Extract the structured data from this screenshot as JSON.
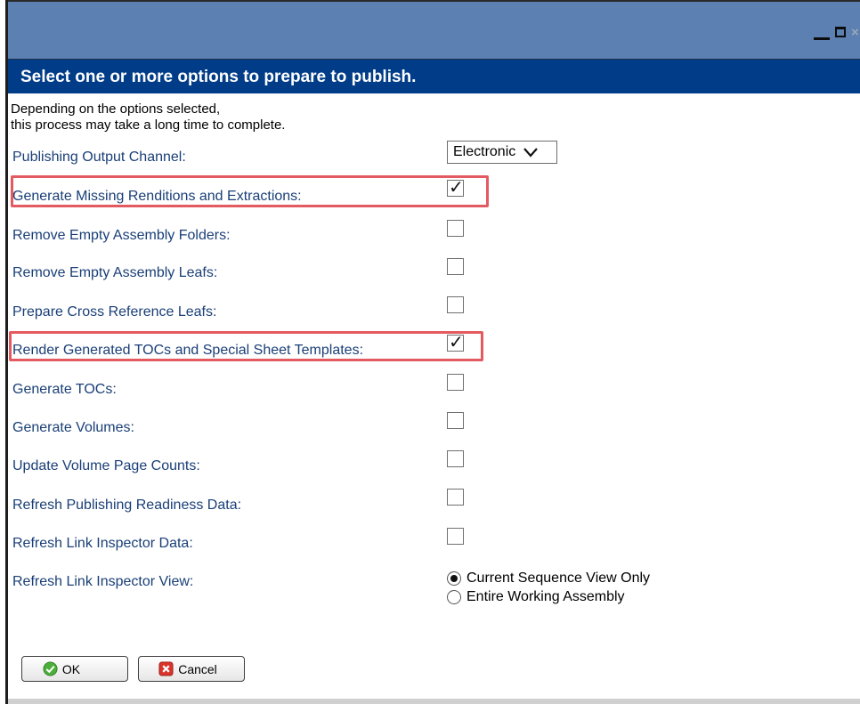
{
  "header": {
    "title": "Select one or more options to prepare to publish."
  },
  "intro": {
    "line1": "Depending on the options selected,",
    "line2": "this process may take a long time to complete."
  },
  "output_channel": {
    "label": "Publishing Output Channel:",
    "selected": "Electronic"
  },
  "options": [
    {
      "label": "Generate Missing Renditions and Extractions:",
      "checked": true
    },
    {
      "label": "Remove Empty Assembly Folders:",
      "checked": false
    },
    {
      "label": "Remove Empty Assembly Leafs:",
      "checked": false
    },
    {
      "label": "Prepare Cross Reference Leafs:",
      "checked": false
    },
    {
      "label": "Render Generated TOCs and Special Sheet Templates:",
      "checked": true
    },
    {
      "label": "Generate TOCs:",
      "checked": false
    },
    {
      "label": "Generate Volumes:",
      "checked": false
    },
    {
      "label": "Update Volume Page Counts:",
      "checked": false
    },
    {
      "label": "Refresh Publishing Readiness Data:",
      "checked": false
    },
    {
      "label": "Refresh Link Inspector Data:",
      "checked": false
    }
  ],
  "inspector_view": {
    "label": "Refresh Link Inspector View:",
    "option1": "Current Sequence View Only",
    "option2": "Entire Working Assembly",
    "selected": "Current Sequence View Only"
  },
  "buttons": {
    "ok": "OK",
    "cancel": "Cancel"
  },
  "colors": {
    "titlebar": "#5b80b1",
    "header": "#003c87",
    "label": "#1a3f77",
    "highlight": "#e35a60",
    "ok_icon": "#4caf3a",
    "cancel_icon": "#d9342b"
  }
}
